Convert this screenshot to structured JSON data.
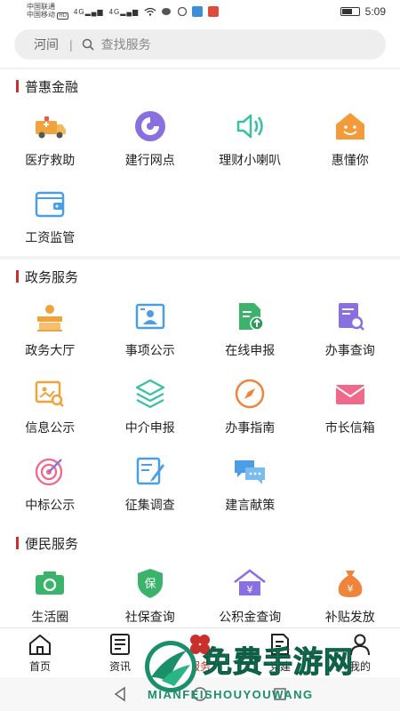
{
  "status_bar": {
    "carrier_1": "中国联通",
    "carrier_2": "中国移动",
    "hd_badge": "HD",
    "signal_1": "4G",
    "signal_2": "4G",
    "time": "5:09"
  },
  "search": {
    "city": "河间",
    "separator": "|",
    "placeholder": "查找服务"
  },
  "sections": {
    "finance": {
      "title": "普惠金融",
      "items": [
        {
          "label": "医疗救助",
          "icon": "ambulance-icon"
        },
        {
          "label": "建行网点",
          "icon": "ccb-logo-icon"
        },
        {
          "label": "理财小喇叭",
          "icon": "speaker-icon"
        },
        {
          "label": "惠懂你",
          "icon": "smiley-house-icon"
        },
        {
          "label": "工资监管",
          "icon": "wallet-icon"
        }
      ]
    },
    "government": {
      "title": "政务服务",
      "items": [
        {
          "label": "政务大厅",
          "icon": "service-desk-icon"
        },
        {
          "label": "事项公示",
          "icon": "id-board-icon"
        },
        {
          "label": "在线申报",
          "icon": "upload-document-icon"
        },
        {
          "label": "办事查询",
          "icon": "document-search-icon"
        },
        {
          "label": "信息公示",
          "icon": "info-search-icon"
        },
        {
          "label": "中介申报",
          "icon": "layers-icon"
        },
        {
          "label": "办事指南",
          "icon": "compass-icon"
        },
        {
          "label": "市长信箱",
          "icon": "mail-icon"
        },
        {
          "label": "中标公示",
          "icon": "target-icon"
        },
        {
          "label": "征集调查",
          "icon": "edit-form-icon"
        },
        {
          "label": "建言献策",
          "icon": "chat-bubbles-icon"
        }
      ]
    },
    "civil": {
      "title": "便民服务",
      "items": [
        {
          "label": "生活圈",
          "icon": "camera-icon"
        },
        {
          "label": "社保查询",
          "icon": "shield-icon"
        },
        {
          "label": "公积金查询",
          "icon": "yuan-house-icon"
        },
        {
          "label": "补贴发放",
          "icon": "money-bag-icon"
        }
      ]
    }
  },
  "tabbar": {
    "tabs": [
      {
        "label": "首页",
        "icon": "home-icon"
      },
      {
        "label": "资讯",
        "icon": "news-icon"
      },
      {
        "label": "服务",
        "icon": "flower-icon"
      },
      {
        "label": "党建",
        "icon": "party-doc-icon"
      },
      {
        "label": "我的",
        "icon": "person-icon"
      }
    ]
  },
  "watermark": {
    "cn": "免费手游网",
    "en": "MIANFEISHOUYOUWANG"
  },
  "colors": {
    "accent_red": "#c9302c",
    "icon_orange": "#f0a23b",
    "icon_purple": "#8a6fe0",
    "icon_teal": "#3bbfa5",
    "icon_blue": "#4a9ee6",
    "icon_green": "#3bb36b",
    "icon_pink": "#ef6a8a"
  }
}
